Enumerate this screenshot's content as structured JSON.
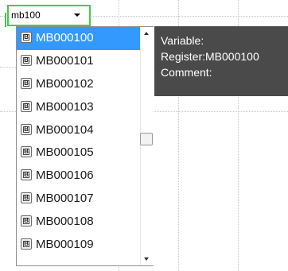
{
  "combo": {
    "value": "mb100",
    "arrow_icon": "chevron-down-icon"
  },
  "dropdown": {
    "items": [
      {
        "icon": "B",
        "label": "MB000100",
        "selected": true
      },
      {
        "icon": "B",
        "label": "MB000101",
        "selected": false
      },
      {
        "icon": "B",
        "label": "MB000102",
        "selected": false
      },
      {
        "icon": "B",
        "label": "MB000103",
        "selected": false
      },
      {
        "icon": "B",
        "label": "MB000104",
        "selected": false
      },
      {
        "icon": "B",
        "label": "MB000105",
        "selected": false
      },
      {
        "icon": "B",
        "label": "MB000106",
        "selected": false
      },
      {
        "icon": "B",
        "label": "MB000107",
        "selected": false
      },
      {
        "icon": "B",
        "label": "MB000108",
        "selected": false
      },
      {
        "icon": "B",
        "label": "MB000109",
        "selected": false
      }
    ],
    "selected_color": "#3399ff"
  },
  "tooltip": {
    "variable": "Variable:",
    "register": "Register:MB000100",
    "comment": "Comment:",
    "background": "#4a4a4a"
  }
}
